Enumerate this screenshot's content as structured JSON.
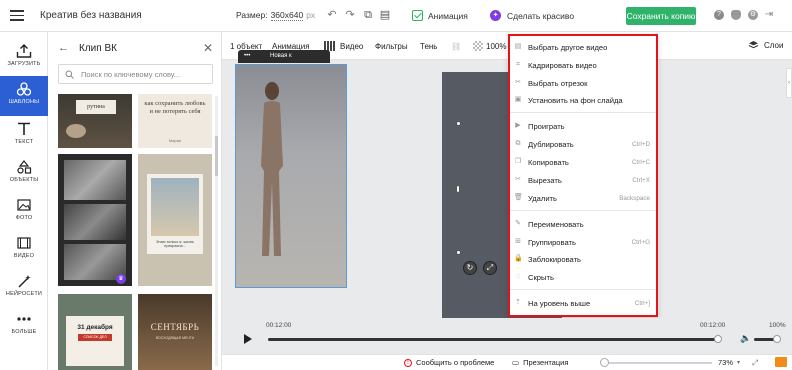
{
  "topbar": {
    "title": "Креатив без названия",
    "size_label": "Размер:",
    "size_value": "360x640",
    "size_unit": "px",
    "animation_label": "Анимация",
    "beautify_label": "Сделать красиво",
    "save_copy_label": "Сохранить копию"
  },
  "rail": {
    "items": [
      {
        "label": "ЗАГРУЗИТЬ",
        "icon": "upload-icon"
      },
      {
        "label": "ШАБЛОНЫ",
        "icon": "templates-icon"
      },
      {
        "label": "ТЕКСТ",
        "icon": "text-icon"
      },
      {
        "label": "ОБЪЕКТЫ",
        "icon": "objects-icon"
      },
      {
        "label": "ФОТО",
        "icon": "photo-icon"
      },
      {
        "label": "ВИДЕО",
        "icon": "video-icon"
      },
      {
        "label": "НЕЙРОСЕТИ",
        "icon": "ai-icon"
      },
      {
        "label": "БОЛЬШЕ",
        "icon": "more-icon"
      }
    ]
  },
  "panel": {
    "title": "Клип ВК",
    "search_placeholder": "Поиск по ключевому слову...",
    "tpl_rutina": "рутина",
    "tpl_quote": "как сохранить любовь и не потерять себя",
    "tpl_quote_author": "Мария",
    "tpl_seaside_caption": "Знаю только я: жизнь прекрасна...",
    "tpl_date_big": "31 декабря",
    "tpl_date_sub": "СПИСОК ДЕЛ",
    "tpl_sept": "СЕНТЯБРЬ",
    "tpl_sept_sub": "ВОСХОДЯЩАЯ МЕЧТА"
  },
  "toolbar": {
    "count": "1 объект",
    "animation": "Анимация",
    "video": "Видео",
    "filters": "Фильтры",
    "shadow": "Тень",
    "opacity": "100%",
    "layers": "Слои"
  },
  "canvas": {
    "video_bar_text": "Новая к"
  },
  "context_menu": {
    "items": [
      {
        "label": "Выбрать другое видео",
        "shortcut": ""
      },
      {
        "label": "Кадрировать видео",
        "shortcut": ""
      },
      {
        "label": "Выбрать отрезок",
        "shortcut": ""
      },
      {
        "label": "Установить на фон слайда",
        "shortcut": ""
      },
      {
        "label": "Проиграть",
        "shortcut": ""
      },
      {
        "label": "Дублировать",
        "shortcut": "Ctrl+D"
      },
      {
        "label": "Копировать",
        "shortcut": "Ctrl+C"
      },
      {
        "label": "Вырезать",
        "shortcut": "Ctrl+X"
      },
      {
        "label": "Удалить",
        "shortcut": "Backspace"
      },
      {
        "label": "Переименовать",
        "shortcut": ""
      },
      {
        "label": "Группировать",
        "shortcut": "Ctrl+G"
      },
      {
        "label": "Заблокировать",
        "shortcut": ""
      },
      {
        "label": "Скрыть",
        "shortcut": ""
      },
      {
        "label": "На уровень выше",
        "shortcut": "Ctrl+]"
      }
    ]
  },
  "player": {
    "time_start": "00:12:00",
    "time_end": "00:12:00",
    "volume": "100%"
  },
  "bottombar": {
    "report": "Сообщить о проблеме",
    "presentation": "Презентация",
    "zoom": "73%"
  },
  "colors": {
    "accent": "#2c5fd4",
    "save_green": "#2fb36a",
    "highlight_red": "#e3131b"
  }
}
